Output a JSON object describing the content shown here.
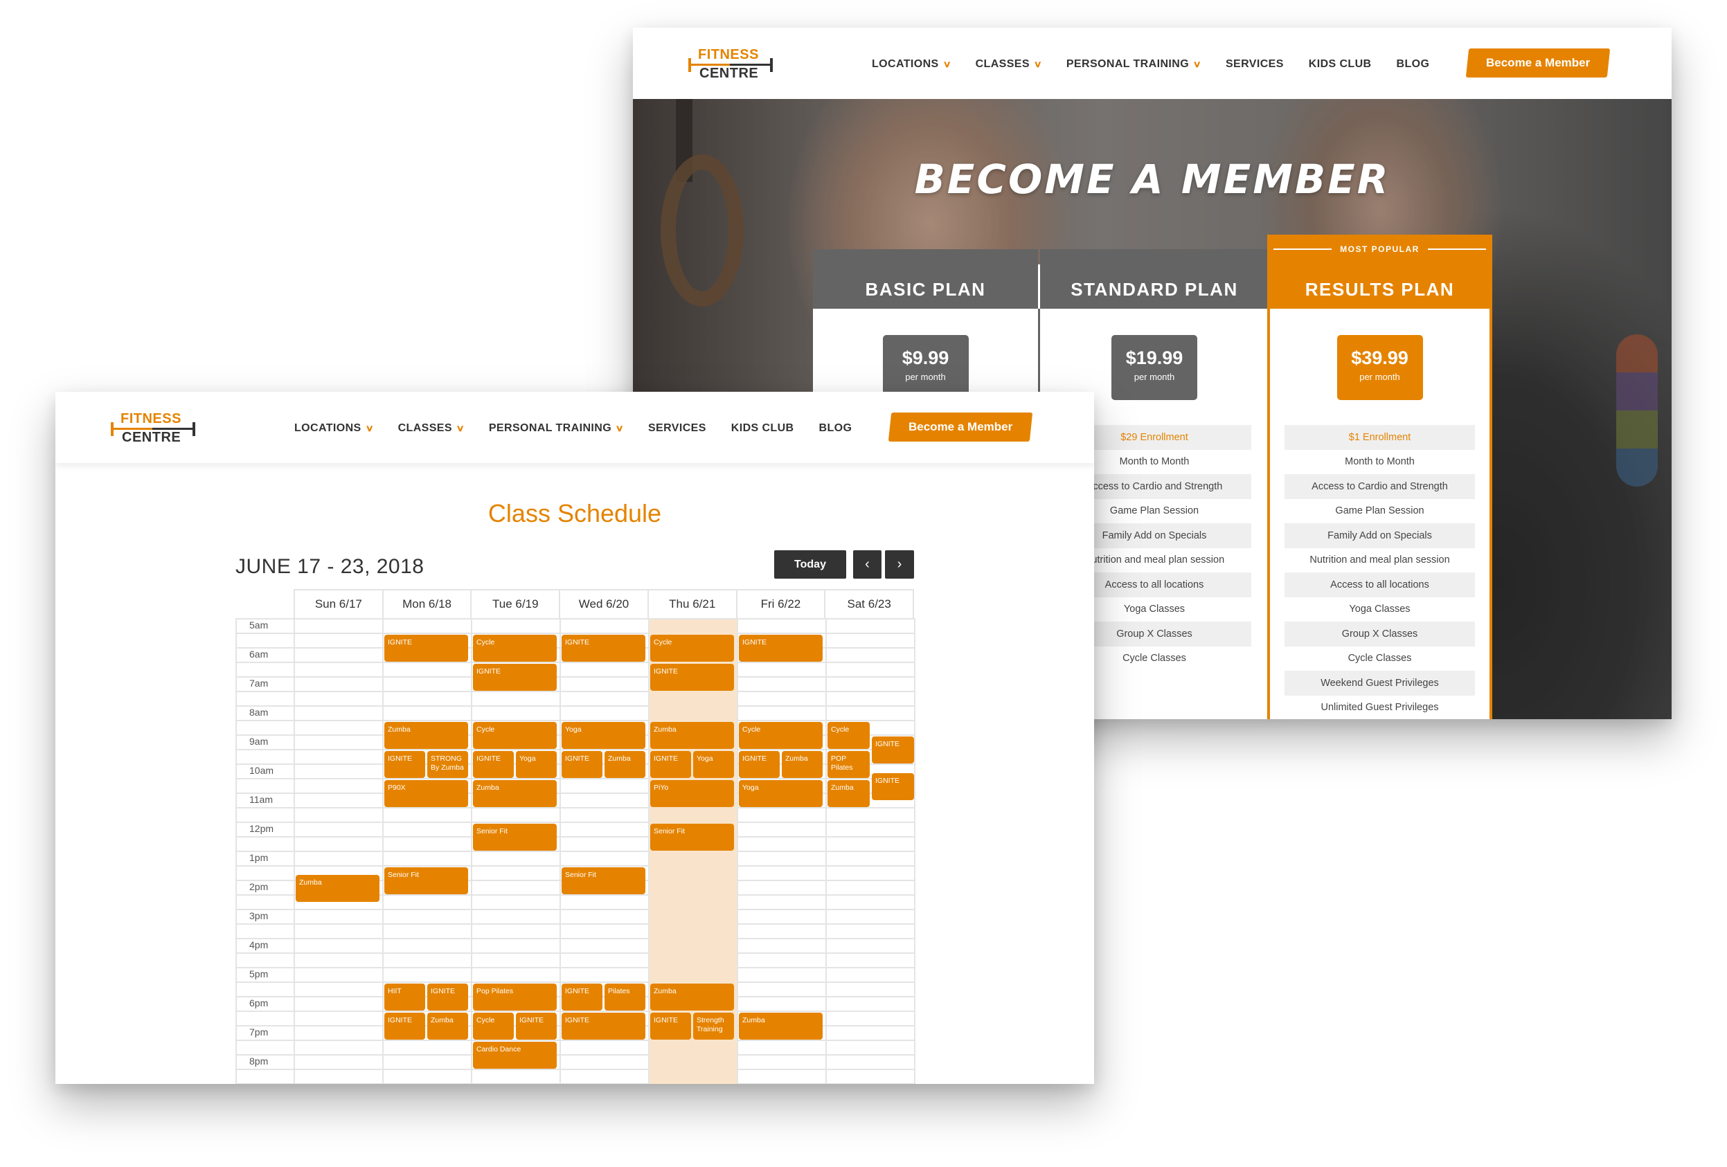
{
  "brand": {
    "line1": "FITNESS",
    "line2": "CENTRE",
    "accent": "#e58300",
    "dark": "#333333"
  },
  "nav": {
    "items": [
      {
        "label": "LOCATIONS",
        "has_dropdown": true
      },
      {
        "label": "CLASSES",
        "has_dropdown": true
      },
      {
        "label": "PERSONAL TRAINING",
        "has_dropdown": true
      },
      {
        "label": "SERVICES",
        "has_dropdown": false
      },
      {
        "label": "KIDS CLUB",
        "has_dropdown": false
      },
      {
        "label": "BLOG",
        "has_dropdown": false
      }
    ],
    "dropdown_glyph": "∨",
    "cta_label": "Become a Member"
  },
  "membership_page": {
    "hero_title": "BECOME A MEMBER",
    "popular_badge": "MOST POPULAR",
    "plans": [
      {
        "name": "BASIC PLAN",
        "price": "$9.99",
        "period": "per month",
        "features": []
      },
      {
        "name": "STANDARD PLAN",
        "price": "$19.99",
        "period": "per month",
        "features": [
          "$29 Enrollment",
          "Month to Month",
          "Access to Cardio and Strength",
          "Game Plan Session",
          "Family Add on Specials",
          "Nutrition and meal plan session",
          "Access to all locations",
          "Yoga Classes",
          "Group X Classes",
          "Cycle Classes"
        ]
      },
      {
        "name": "RESULTS PLAN",
        "price": "$39.99",
        "period": "per month",
        "features": [
          "$1 Enrollment",
          "Month to Month",
          "Access to Cardio and Strength",
          "Game Plan Session",
          "Family Add on Specials",
          "Nutrition and meal plan session",
          "Access to all locations",
          "Yoga Classes",
          "Group X Classes",
          "Cycle Classes",
          "Weekend Guest Privileges",
          "Unlimited Guest Privileges"
        ]
      }
    ]
  },
  "schedule_page": {
    "title": "Class Schedule",
    "date_range": "JUNE 17 - 23, 2018",
    "today_label": "Today",
    "prev_glyph": "‹",
    "next_glyph": "›",
    "today_index": 4,
    "days": [
      "Sun 6/17",
      "Mon 6/18",
      "Tue 6/19",
      "Wed 6/20",
      "Thu 6/21",
      "Fri 6/22",
      "Sat 6/23"
    ],
    "time_labels": [
      "5am",
      "6am",
      "7am",
      "8am",
      "9am",
      "10am",
      "11am",
      "12pm",
      "1pm",
      "2pm",
      "3pm",
      "4pm",
      "5pm",
      "6pm",
      "7pm",
      "8pm"
    ],
    "events": [
      {
        "day": 1,
        "start": 5.5,
        "end": 6.5,
        "name": "IGNITE"
      },
      {
        "day": 2,
        "start": 5.5,
        "end": 6.5,
        "name": "Cycle"
      },
      {
        "day": 3,
        "start": 5.5,
        "end": 6.5,
        "name": "IGNITE"
      },
      {
        "day": 4,
        "start": 5.5,
        "end": 6.5,
        "name": "Cycle"
      },
      {
        "day": 5,
        "start": 5.5,
        "end": 6.5,
        "name": "IGNITE"
      },
      {
        "day": 2,
        "start": 6.5,
        "end": 7.5,
        "name": "IGNITE"
      },
      {
        "day": 4,
        "start": 6.5,
        "end": 7.5,
        "name": "IGNITE"
      },
      {
        "day": 1,
        "start": 8.5,
        "end": 9.5,
        "name": "Zumba"
      },
      {
        "day": 2,
        "start": 8.5,
        "end": 9.5,
        "name": "Cycle"
      },
      {
        "day": 3,
        "start": 8.5,
        "end": 9.5,
        "name": "Yoga"
      },
      {
        "day": 4,
        "start": 8.5,
        "end": 9.5,
        "name": "Zumba"
      },
      {
        "day": 5,
        "start": 8.5,
        "end": 9.5,
        "name": "Cycle"
      },
      {
        "day": 6,
        "start": 8.5,
        "end": 9.5,
        "name": "Cycle",
        "lane": 0,
        "lanes": 2
      },
      {
        "day": 6,
        "start": 9.0,
        "end": 10.0,
        "name": "IGNITE",
        "lane": 1,
        "lanes": 2
      },
      {
        "day": 1,
        "start": 9.5,
        "end": 10.5,
        "name": "IGNITE",
        "lane": 0,
        "lanes": 2
      },
      {
        "day": 1,
        "start": 9.5,
        "end": 10.5,
        "name": "STRONG By Zumba",
        "lane": 1,
        "lanes": 2
      },
      {
        "day": 2,
        "start": 9.5,
        "end": 10.5,
        "name": "IGNITE",
        "lane": 0,
        "lanes": 2
      },
      {
        "day": 2,
        "start": 9.5,
        "end": 10.5,
        "name": "Yoga",
        "lane": 1,
        "lanes": 2
      },
      {
        "day": 3,
        "start": 9.5,
        "end": 10.5,
        "name": "IGNITE",
        "lane": 0,
        "lanes": 2
      },
      {
        "day": 3,
        "start": 9.5,
        "end": 10.5,
        "name": "Zumba",
        "lane": 1,
        "lanes": 2
      },
      {
        "day": 4,
        "start": 9.5,
        "end": 10.5,
        "name": "IGNITE",
        "lane": 0,
        "lanes": 2
      },
      {
        "day": 4,
        "start": 9.5,
        "end": 10.5,
        "name": "Yoga",
        "lane": 1,
        "lanes": 2
      },
      {
        "day": 5,
        "start": 9.5,
        "end": 10.5,
        "name": "IGNITE",
        "lane": 0,
        "lanes": 2
      },
      {
        "day": 5,
        "start": 9.5,
        "end": 10.5,
        "name": "Zumba",
        "lane": 1,
        "lanes": 2
      },
      {
        "day": 6,
        "start": 9.5,
        "end": 10.5,
        "name": "POP Pilates",
        "lane": 0,
        "lanes": 2
      },
      {
        "day": 6,
        "start": 10.25,
        "end": 11.25,
        "name": "IGNITE",
        "lane": 1,
        "lanes": 2
      },
      {
        "day": 1,
        "start": 10.5,
        "end": 11.5,
        "name": "P90X"
      },
      {
        "day": 2,
        "start": 10.5,
        "end": 11.5,
        "name": "Zumba"
      },
      {
        "day": 4,
        "start": 10.5,
        "end": 11.5,
        "name": "PiYo"
      },
      {
        "day": 5,
        "start": 10.5,
        "end": 11.5,
        "name": "Yoga"
      },
      {
        "day": 6,
        "start": 10.5,
        "end": 11.5,
        "name": "Zumba",
        "lane": 0,
        "lanes": 2
      },
      {
        "day": 2,
        "start": 12.0,
        "end": 13.0,
        "name": "Senior Fit"
      },
      {
        "day": 4,
        "start": 12.0,
        "end": 13.0,
        "name": "Senior Fit"
      },
      {
        "day": 1,
        "start": 13.5,
        "end": 14.5,
        "name": "Senior Fit"
      },
      {
        "day": 3,
        "start": 13.5,
        "end": 14.5,
        "name": "Senior Fit"
      },
      {
        "day": 0,
        "start": 13.75,
        "end": 14.75,
        "name": "Zumba"
      },
      {
        "day": 1,
        "start": 17.5,
        "end": 18.5,
        "name": "HIIT",
        "lane": 0,
        "lanes": 2
      },
      {
        "day": 1,
        "start": 17.5,
        "end": 18.5,
        "name": "IGNITE",
        "lane": 1,
        "lanes": 2
      },
      {
        "day": 2,
        "start": 17.5,
        "end": 18.5,
        "name": "Pop Pilates"
      },
      {
        "day": 3,
        "start": 17.5,
        "end": 18.5,
        "name": "IGNITE",
        "lane": 0,
        "lanes": 2
      },
      {
        "day": 3,
        "start": 17.5,
        "end": 18.5,
        "name": "Pilates",
        "lane": 1,
        "lanes": 2
      },
      {
        "day": 4,
        "start": 17.5,
        "end": 18.5,
        "name": "Zumba"
      },
      {
        "day": 1,
        "start": 18.5,
        "end": 19.5,
        "name": "IGNITE",
        "lane": 0,
        "lanes": 2
      },
      {
        "day": 1,
        "start": 18.5,
        "end": 19.5,
        "name": "Zumba",
        "lane": 1,
        "lanes": 2
      },
      {
        "day": 2,
        "start": 18.5,
        "end": 19.5,
        "name": "Cycle",
        "lane": 0,
        "lanes": 2
      },
      {
        "day": 2,
        "start": 18.5,
        "end": 19.5,
        "name": "IGNITE",
        "lane": 1,
        "lanes": 2
      },
      {
        "day": 3,
        "start": 18.5,
        "end": 19.5,
        "name": "IGNITE"
      },
      {
        "day": 4,
        "start": 18.5,
        "end": 19.5,
        "name": "IGNITE",
        "lane": 0,
        "lanes": 2
      },
      {
        "day": 4,
        "start": 18.5,
        "end": 19.5,
        "name": "Strength Training",
        "lane": 1,
        "lanes": 2
      },
      {
        "day": 5,
        "start": 18.5,
        "end": 19.5,
        "name": "Zumba"
      },
      {
        "day": 2,
        "start": 19.5,
        "end": 20.5,
        "name": "Cardio Dance"
      }
    ]
  }
}
